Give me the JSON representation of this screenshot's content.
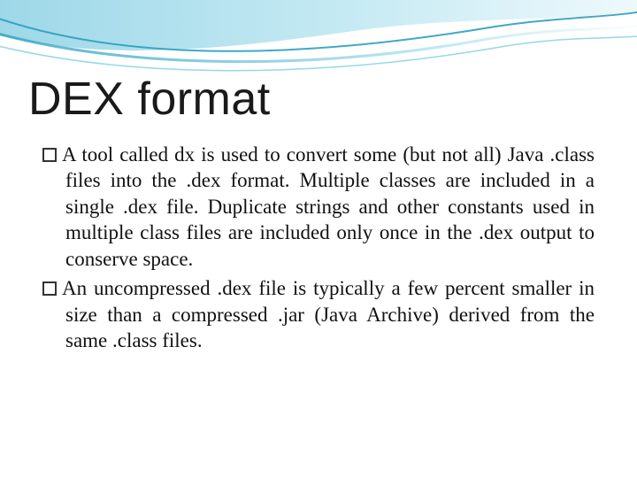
{
  "slide": {
    "title": "DEX format",
    "bullets": [
      {
        "text": "A tool called dx is used to convert some (but not all) Java .class files into the .dex format. Multiple classes are included in a single .dex file. Duplicate strings and other constants used in multiple class files are included only once in the .dex output to conserve space."
      },
      {
        "text": "An uncompressed .dex file is typically a few percent smaller in size than a compressed .jar (Java Archive) derived from the same .class files."
      }
    ]
  }
}
